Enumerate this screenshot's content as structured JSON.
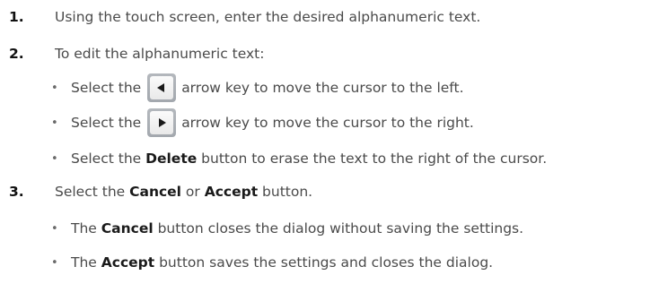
{
  "steps": [
    {
      "number": "1.",
      "text": "Using the touch screen, enter the desired alphanumeric text."
    },
    {
      "number": "2.",
      "text": "To edit the alphanumeric text:",
      "bullets": [
        {
          "before": "Select the",
          "icon": "left-arrow-key",
          "after": "arrow key to move the cursor to the left."
        },
        {
          "before": "Select the",
          "icon": "right-arrow-key",
          "after": "arrow key to move the cursor to the right."
        },
        {
          "before": "Select the ",
          "bold": "Delete",
          "after": " button to erase the text to the right of the cursor."
        }
      ]
    },
    {
      "number": "3.",
      "text_before": "Select the ",
      "bold1": "Cancel",
      "text_mid": " or ",
      "bold2": "Accept",
      "text_after": " button.",
      "bullets": [
        {
          "before": "The ",
          "bold": "Cancel",
          "after": " button closes the dialog without saving the settings."
        },
        {
          "before": "The ",
          "bold": "Accept",
          "after": " button saves the settings and closes the dialog."
        }
      ]
    }
  ],
  "bullet_glyph": "•",
  "colors": {
    "text": "#4a4a4a",
    "number": "#111111",
    "key_border": "#a8adb3",
    "key_face": "#f3f3f3",
    "arrow": "#1a1a1a"
  }
}
